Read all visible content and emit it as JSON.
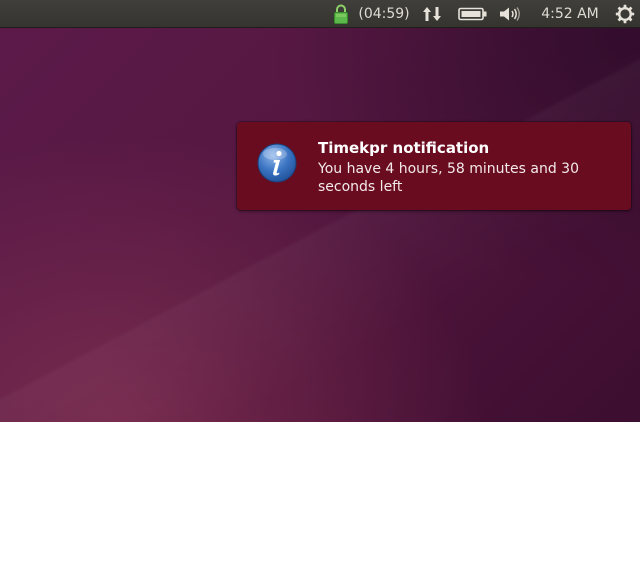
{
  "panel": {
    "timer_text": "(04:59)",
    "clock_text": "4:52 AM",
    "icons": {
      "lock": "lock-icon",
      "network": "network-transfer-icon",
      "battery": "battery-icon",
      "volume": "volume-icon",
      "system": "gear-icon"
    },
    "lock_color": "#4caf50"
  },
  "notification": {
    "title": "Timekpr notification",
    "body": "You have 4 hours, 58 minutes and 30 seconds left",
    "icon": "info-icon",
    "background_color": "#6a0c1f",
    "icon_color": "#3b74c2"
  }
}
